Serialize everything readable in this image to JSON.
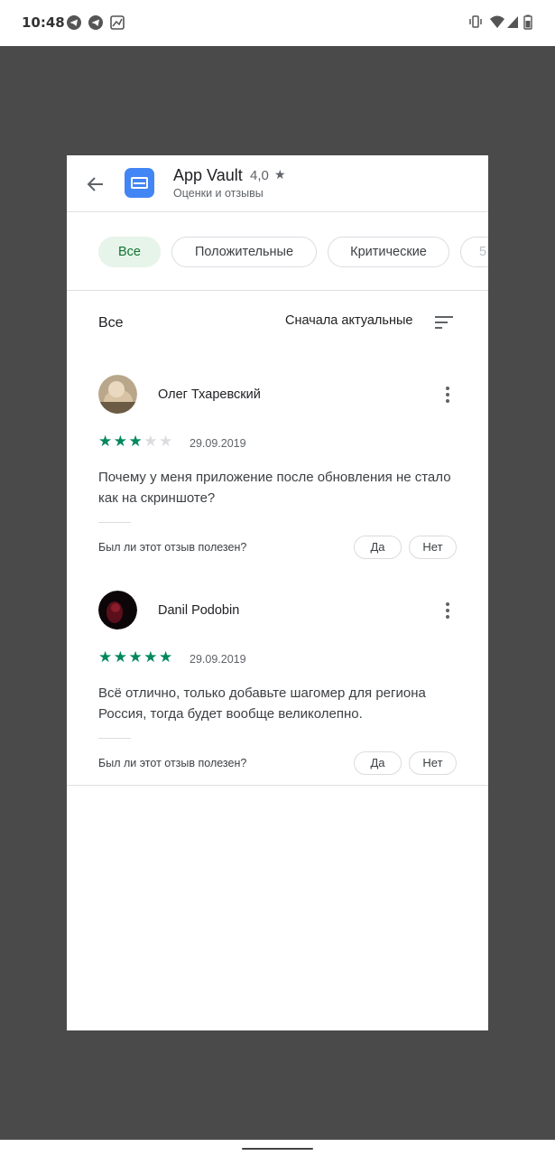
{
  "status_bar": {
    "time": "10:48",
    "left_icons": [
      "telegram-icon",
      "telegram-icon",
      "image-icon"
    ],
    "right_icons": [
      "vibrate-icon",
      "wifi-icon",
      "signal-icon",
      "battery-icon"
    ]
  },
  "header": {
    "app_name": "App Vault",
    "rating": "4,0",
    "star": "★",
    "subtitle": "Оценки и отзывы",
    "accent": "#4285f4"
  },
  "filters": [
    {
      "label": "Все",
      "active": true
    },
    {
      "label": "Положительные",
      "active": false
    },
    {
      "label": "Критические",
      "active": false
    },
    {
      "label": "5",
      "active": false
    }
  ],
  "sort": {
    "title": "Все",
    "mode": "Сначала актуальные"
  },
  "reviews": [
    {
      "name": "Олег Тхаревский",
      "rating": 3,
      "stars_on": "★★★",
      "stars_off": "★★",
      "date": "29.09.2019",
      "text": "Почему у меня приложение после обновления не стало как на скриншоте?",
      "helpful_question": "Был ли этот отзыв полезен?",
      "yes": "Да",
      "no": "Нет"
    },
    {
      "name": "Danil Podobin",
      "rating": 5,
      "stars_on": "★★★★★",
      "stars_off": "",
      "date": "29.09.2019",
      "text": "Всё отлично, только добавьте шагомер для региона Россия, тогда будет вообще великолепно.",
      "helpful_question": "Был ли этот отзыв полезен?",
      "yes": "Да",
      "no": "Нет"
    }
  ],
  "colors": {
    "star_green": "#01875f",
    "chip_active_bg": "#e6f4ea",
    "chip_active_text": "#137333",
    "backdrop": "#4a4a4a"
  }
}
